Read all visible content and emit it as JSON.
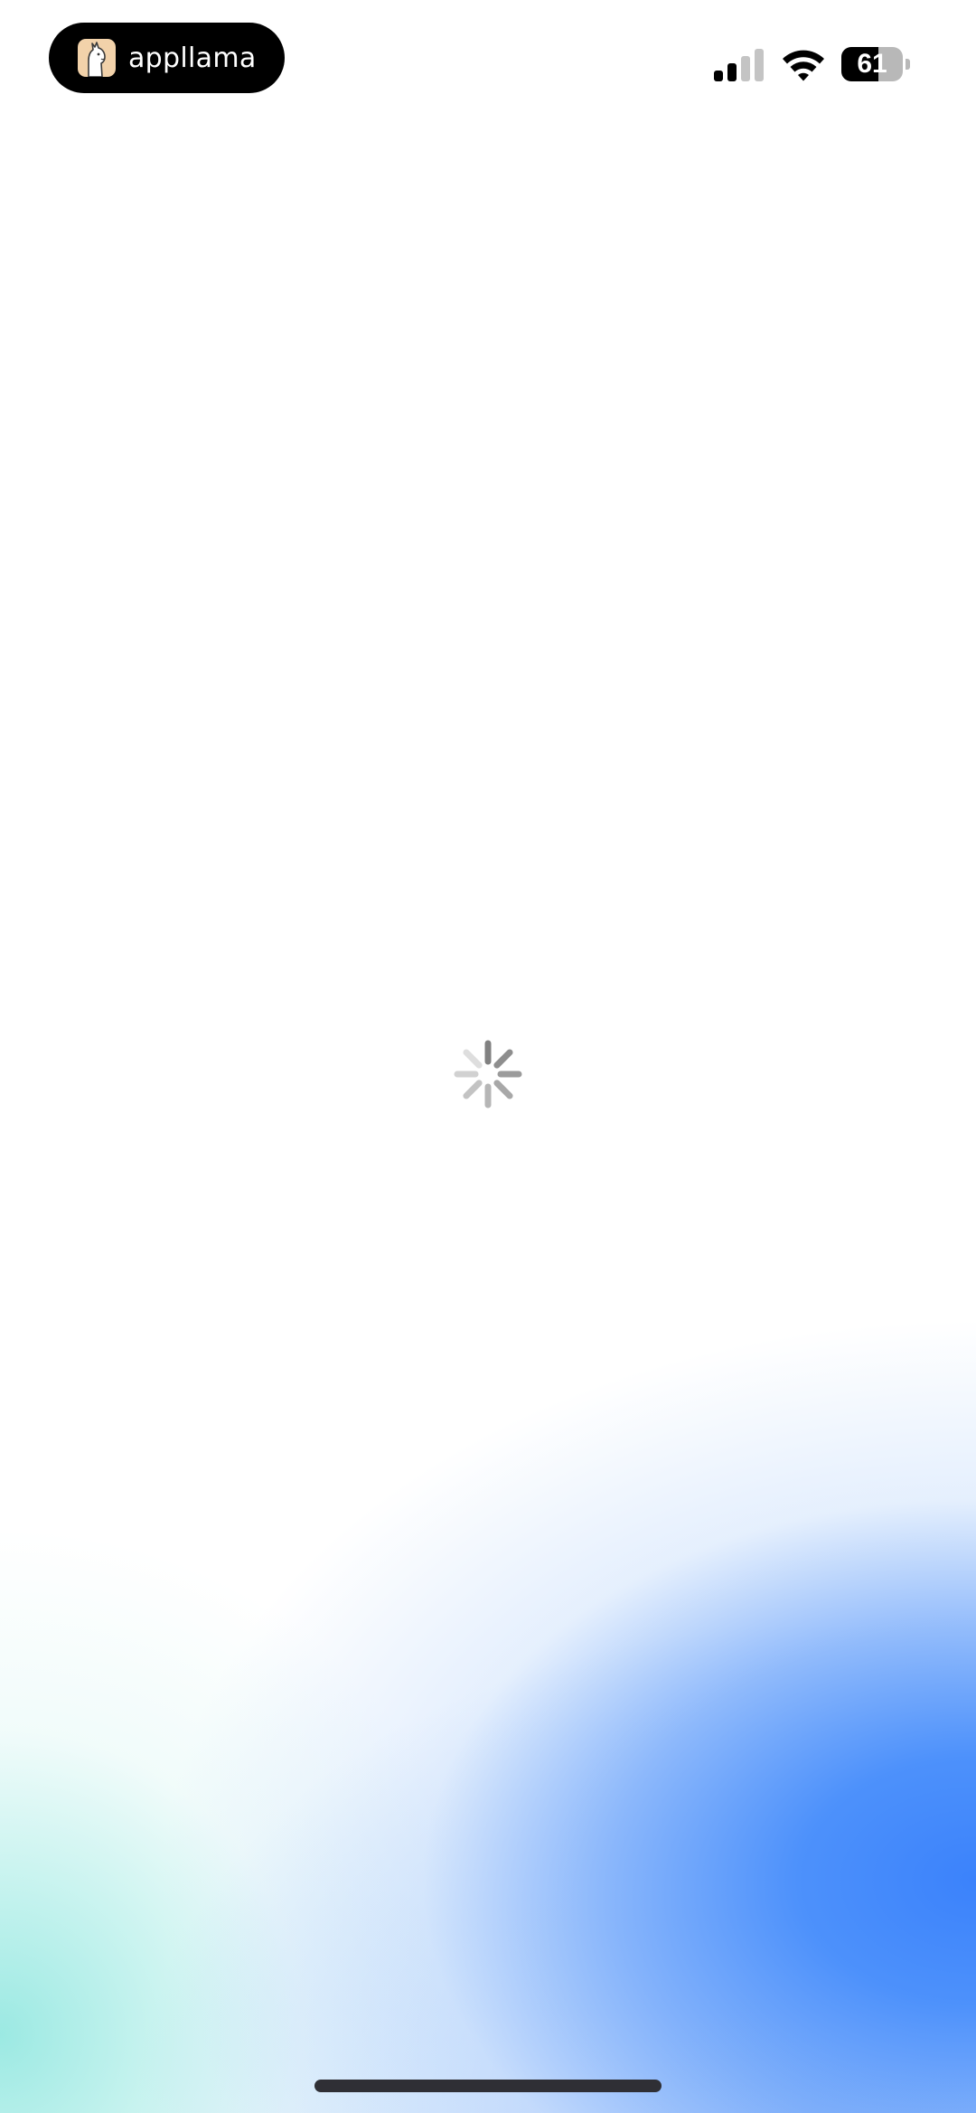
{
  "status_bar": {
    "recording_app_name": "appllama",
    "signal_strength_bars": 2,
    "signal_total_bars": 4,
    "wifi": "wifi-icon",
    "battery_percent": "61",
    "battery_level": 0.61
  },
  "content": {
    "state": "loading",
    "spinner": "activity-spinner-icon"
  },
  "colors": {
    "pill_background": "#000000",
    "gradient_blue": "#3b82fb",
    "gradient_teal": "#96e8e1",
    "home_indicator": "#2f2f35"
  }
}
